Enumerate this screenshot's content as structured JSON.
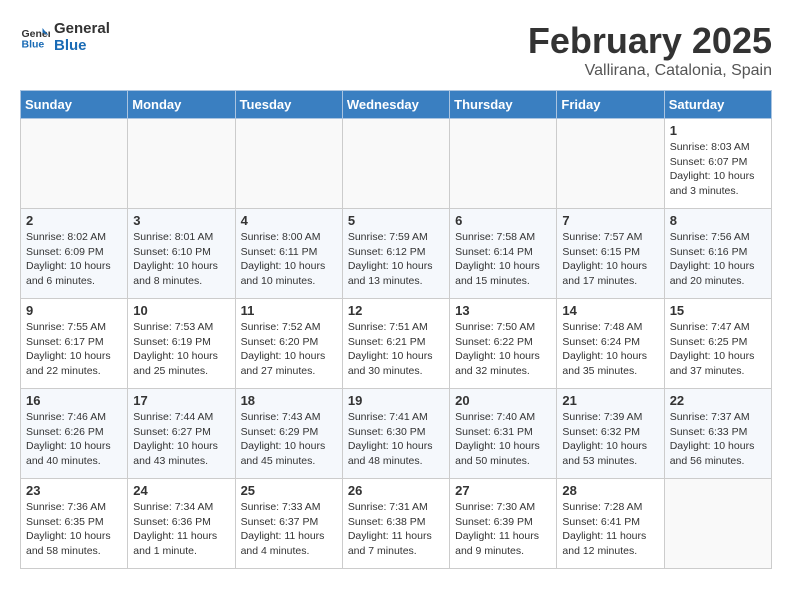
{
  "logo": {
    "line1": "General",
    "line2": "Blue"
  },
  "title": "February 2025",
  "location": "Vallirana, Catalonia, Spain",
  "days_of_week": [
    "Sunday",
    "Monday",
    "Tuesday",
    "Wednesday",
    "Thursday",
    "Friday",
    "Saturday"
  ],
  "weeks": [
    [
      {
        "day": "",
        "text": ""
      },
      {
        "day": "",
        "text": ""
      },
      {
        "day": "",
        "text": ""
      },
      {
        "day": "",
        "text": ""
      },
      {
        "day": "",
        "text": ""
      },
      {
        "day": "",
        "text": ""
      },
      {
        "day": "1",
        "text": "Sunrise: 8:03 AM\nSunset: 6:07 PM\nDaylight: 10 hours\nand 3 minutes."
      }
    ],
    [
      {
        "day": "2",
        "text": "Sunrise: 8:02 AM\nSunset: 6:09 PM\nDaylight: 10 hours\nand 6 minutes."
      },
      {
        "day": "3",
        "text": "Sunrise: 8:01 AM\nSunset: 6:10 PM\nDaylight: 10 hours\nand 8 minutes."
      },
      {
        "day": "4",
        "text": "Sunrise: 8:00 AM\nSunset: 6:11 PM\nDaylight: 10 hours\nand 10 minutes."
      },
      {
        "day": "5",
        "text": "Sunrise: 7:59 AM\nSunset: 6:12 PM\nDaylight: 10 hours\nand 13 minutes."
      },
      {
        "day": "6",
        "text": "Sunrise: 7:58 AM\nSunset: 6:14 PM\nDaylight: 10 hours\nand 15 minutes."
      },
      {
        "day": "7",
        "text": "Sunrise: 7:57 AM\nSunset: 6:15 PM\nDaylight: 10 hours\nand 17 minutes."
      },
      {
        "day": "8",
        "text": "Sunrise: 7:56 AM\nSunset: 6:16 PM\nDaylight: 10 hours\nand 20 minutes."
      }
    ],
    [
      {
        "day": "9",
        "text": "Sunrise: 7:55 AM\nSunset: 6:17 PM\nDaylight: 10 hours\nand 22 minutes."
      },
      {
        "day": "10",
        "text": "Sunrise: 7:53 AM\nSunset: 6:19 PM\nDaylight: 10 hours\nand 25 minutes."
      },
      {
        "day": "11",
        "text": "Sunrise: 7:52 AM\nSunset: 6:20 PM\nDaylight: 10 hours\nand 27 minutes."
      },
      {
        "day": "12",
        "text": "Sunrise: 7:51 AM\nSunset: 6:21 PM\nDaylight: 10 hours\nand 30 minutes."
      },
      {
        "day": "13",
        "text": "Sunrise: 7:50 AM\nSunset: 6:22 PM\nDaylight: 10 hours\nand 32 minutes."
      },
      {
        "day": "14",
        "text": "Sunrise: 7:48 AM\nSunset: 6:24 PM\nDaylight: 10 hours\nand 35 minutes."
      },
      {
        "day": "15",
        "text": "Sunrise: 7:47 AM\nSunset: 6:25 PM\nDaylight: 10 hours\nand 37 minutes."
      }
    ],
    [
      {
        "day": "16",
        "text": "Sunrise: 7:46 AM\nSunset: 6:26 PM\nDaylight: 10 hours\nand 40 minutes."
      },
      {
        "day": "17",
        "text": "Sunrise: 7:44 AM\nSunset: 6:27 PM\nDaylight: 10 hours\nand 43 minutes."
      },
      {
        "day": "18",
        "text": "Sunrise: 7:43 AM\nSunset: 6:29 PM\nDaylight: 10 hours\nand 45 minutes."
      },
      {
        "day": "19",
        "text": "Sunrise: 7:41 AM\nSunset: 6:30 PM\nDaylight: 10 hours\nand 48 minutes."
      },
      {
        "day": "20",
        "text": "Sunrise: 7:40 AM\nSunset: 6:31 PM\nDaylight: 10 hours\nand 50 minutes."
      },
      {
        "day": "21",
        "text": "Sunrise: 7:39 AM\nSunset: 6:32 PM\nDaylight: 10 hours\nand 53 minutes."
      },
      {
        "day": "22",
        "text": "Sunrise: 7:37 AM\nSunset: 6:33 PM\nDaylight: 10 hours\nand 56 minutes."
      }
    ],
    [
      {
        "day": "23",
        "text": "Sunrise: 7:36 AM\nSunset: 6:35 PM\nDaylight: 10 hours\nand 58 minutes."
      },
      {
        "day": "24",
        "text": "Sunrise: 7:34 AM\nSunset: 6:36 PM\nDaylight: 11 hours\nand 1 minute."
      },
      {
        "day": "25",
        "text": "Sunrise: 7:33 AM\nSunset: 6:37 PM\nDaylight: 11 hours\nand 4 minutes."
      },
      {
        "day": "26",
        "text": "Sunrise: 7:31 AM\nSunset: 6:38 PM\nDaylight: 11 hours\nand 7 minutes."
      },
      {
        "day": "27",
        "text": "Sunrise: 7:30 AM\nSunset: 6:39 PM\nDaylight: 11 hours\nand 9 minutes."
      },
      {
        "day": "28",
        "text": "Sunrise: 7:28 AM\nSunset: 6:41 PM\nDaylight: 11 hours\nand 12 minutes."
      },
      {
        "day": "",
        "text": ""
      }
    ]
  ]
}
